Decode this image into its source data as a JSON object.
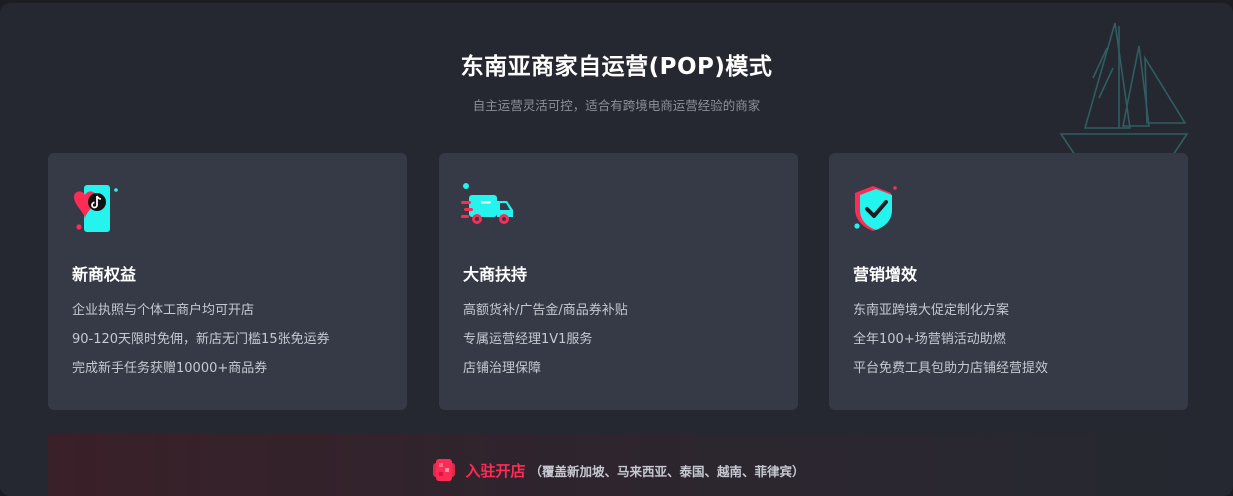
{
  "header": {
    "title": "东南亚商家自运营(POP)模式",
    "subtitle": "自主运营灵活可控，适合有跨境电商运营经验的商家"
  },
  "cards": [
    {
      "icon": "tiktok-phone-heart-icon",
      "title": "新商权益",
      "items": [
        "企业执照与个体工商户均可开店",
        "90-120天限时免佣，新店无门槛15张免运券",
        "完成新手任务获赠10000+商品券"
      ]
    },
    {
      "icon": "delivery-truck-icon",
      "title": "大商扶持",
      "items": [
        "高额货补/广告金/商品券补贴",
        "专属运营经理1V1服务",
        "店铺治理保障"
      ]
    },
    {
      "icon": "shield-check-icon",
      "title": "营销增效",
      "items": [
        "东南亚跨境大促定制化方案",
        "全年100+场营销活动助燃",
        "平台免费工具包助力店铺经营提效"
      ]
    }
  ],
  "banner": {
    "cta": "入驻开店",
    "note": "（覆盖新加坡、马来西亚、泰国、越南、菲律宾）",
    "accent_color": "#fe2c55"
  },
  "colors": {
    "background": "#252830",
    "card": "#353a46",
    "cyan": "#25f4ee",
    "red": "#fe2c55"
  }
}
